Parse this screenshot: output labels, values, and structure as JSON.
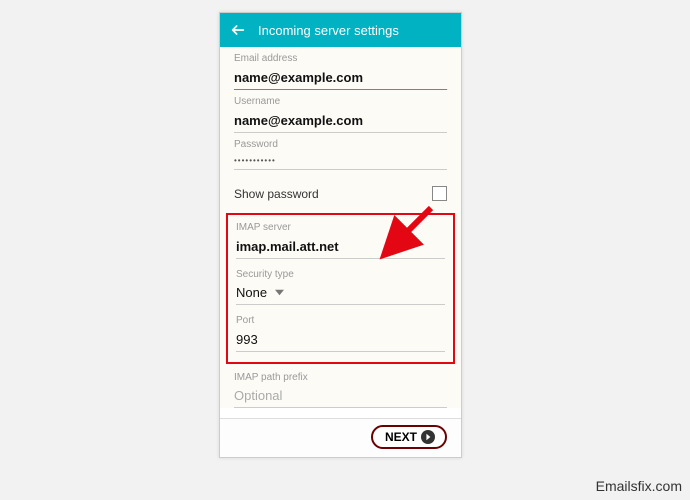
{
  "header": {
    "title": "Incoming server settings"
  },
  "fields": {
    "email_label": "Email address",
    "email_value": "name@example.com",
    "username_label": "Username",
    "username_value": "name@example.com",
    "password_label": "Password",
    "password_value": "•••••••••••",
    "show_password": "Show password",
    "imap_server_label": "IMAP server",
    "imap_server_value": "imap.mail.att.net",
    "security_label": "Security type",
    "security_value": "None",
    "port_label": "Port",
    "port_value": "993",
    "path_prefix_label": "IMAP path prefix",
    "path_prefix_placeholder": "Optional"
  },
  "footer": {
    "next_label": "NEXT"
  },
  "watermark": "Emailsfix.com",
  "colors": {
    "accent": "#00b2c2",
    "highlight": "#e30613"
  }
}
